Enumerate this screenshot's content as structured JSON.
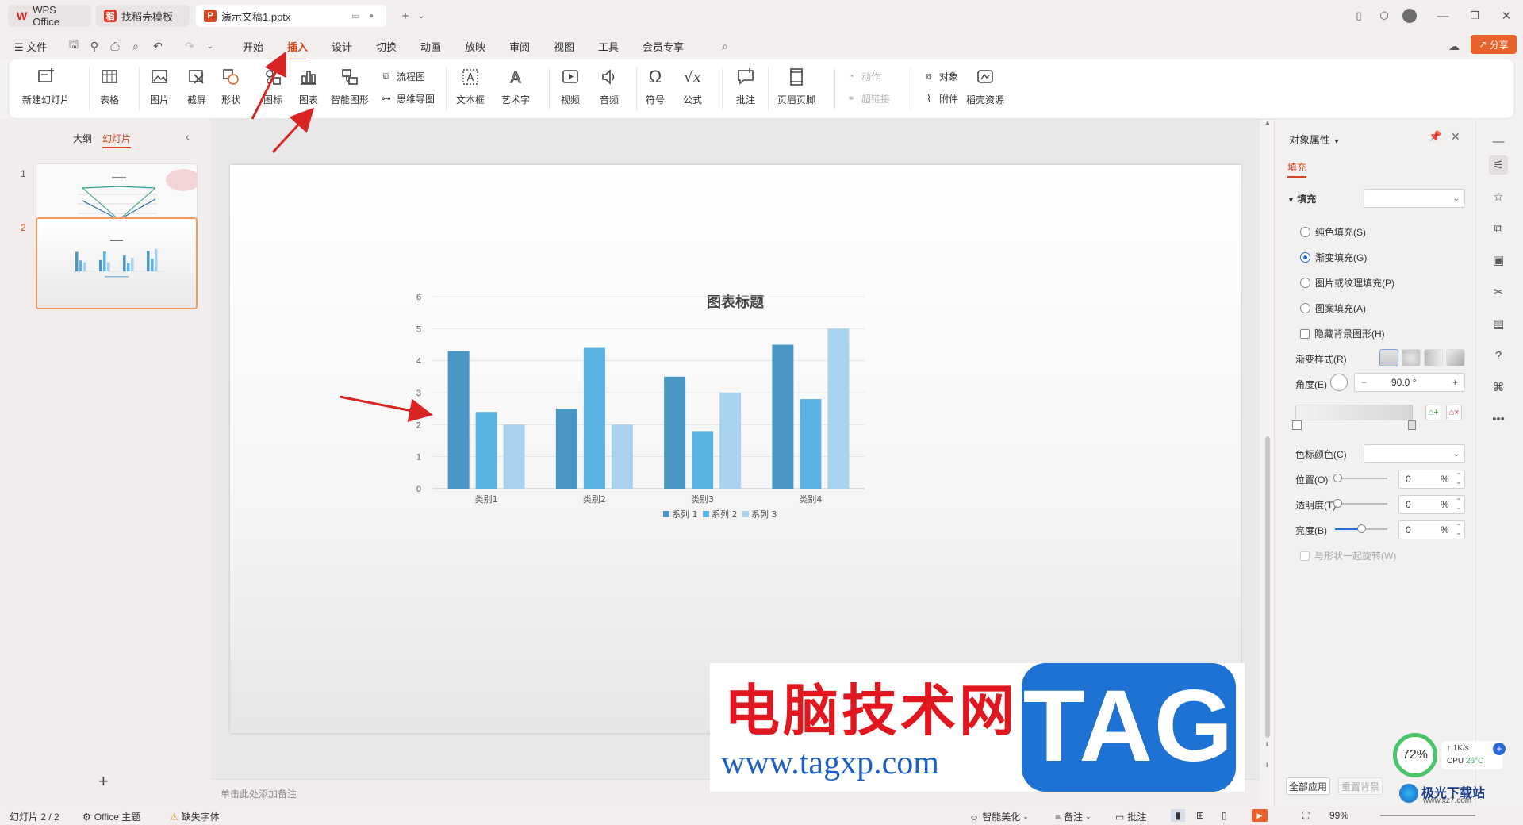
{
  "titlebar": {
    "tabs": [
      {
        "label": "WPS Office",
        "icon": "wps-logo-icon"
      },
      {
        "label": "找稻壳模板",
        "icon": "docer-icon"
      },
      {
        "label": "演示文稿1.pptx",
        "icon": "presentation-icon"
      }
    ]
  },
  "menubar": {
    "file": "文件",
    "items": [
      "开始",
      "插入",
      "设计",
      "切换",
      "动画",
      "放映",
      "审阅",
      "视图",
      "工具",
      "会员专享"
    ],
    "active": "插入",
    "share": "分享"
  },
  "ribbon": {
    "new_slide": "新建幻灯片",
    "table": "表格",
    "picture": "图片",
    "screenshot": "截屏",
    "shape": "形状",
    "icon": "图标",
    "chart": "图表",
    "smartart": "智能图形",
    "flowchart": "流程图",
    "mindmap": "思维导图",
    "textbox": "文本框",
    "wordart": "艺术字",
    "video": "视频",
    "audio": "音频",
    "symbol": "符号",
    "formula": "公式",
    "comment": "批注",
    "header_footer": "页眉页脚",
    "action": "动作",
    "hyperlink": "超链接",
    "object": "对象",
    "attachment": "附件",
    "docer_resources": "稻壳资源"
  },
  "leftpane": {
    "tab_outline": "大纲",
    "tab_slides": "幻灯片",
    "slides": [
      {
        "number": "1",
        "selected": false
      },
      {
        "number": "2",
        "selected": true
      }
    ]
  },
  "chart_data": {
    "type": "bar",
    "title": "图表标题",
    "categories": [
      "类别1",
      "类别2",
      "类别3",
      "类别4"
    ],
    "series": [
      {
        "name": "系列 1",
        "values": [
          4.3,
          2.5,
          3.5,
          4.5
        ],
        "color": "#4a96c4"
      },
      {
        "name": "系列 2",
        "values": [
          2.4,
          4.4,
          1.8,
          2.8
        ],
        "color": "#5bb3e3"
      },
      {
        "name": "系列 3",
        "values": [
          2.0,
          2.0,
          3.0,
          5.0
        ],
        "color": "#a9d2ef"
      }
    ],
    "ylim": [
      0,
      6
    ],
    "yticks": [
      "0",
      "1",
      "2",
      "3",
      "4",
      "5",
      "6"
    ],
    "grid": true,
    "legend": "bottom"
  },
  "notes_placeholder": "单击此处添加备注",
  "rightpane": {
    "title": "对象属性",
    "tab": "填充",
    "section": "填充",
    "fill_options": [
      {
        "label": "纯色填充(S)",
        "checked": false
      },
      {
        "label": "渐变填充(G)",
        "checked": true
      },
      {
        "label": "图片或纹理填充(P)",
        "checked": false
      },
      {
        "label": "图案填充(A)",
        "checked": false
      }
    ],
    "hide_bg": "隐藏背景图形(H)",
    "gradient_style": "渐变样式(R)",
    "angle_label": "角度(E)",
    "angle_value": "90.0 °",
    "stop_color": "色标颜色(C)",
    "position_label": "位置(O)",
    "position_value": "0",
    "transparency_label": "透明度(T)",
    "transparency_value": "0",
    "brightness_label": "亮度(B)",
    "brightness_value": "0",
    "percent": "%",
    "rotate_with_shape": "与形状一起旋转(W)",
    "apply_all": "全部应用",
    "reset_bg": "重置背景"
  },
  "statusbar": {
    "slide_count": "幻灯片 2 / 2",
    "theme": "Office 主题",
    "missing_font": "缺失字体",
    "beautify": "智能美化",
    "notes": "备注",
    "comments": "批注",
    "zoom": "99%"
  },
  "perf_widget": {
    "cpu_pct": "72%",
    "speed": "1K/s",
    "cpu_label": "CPU",
    "temp": "26°C"
  },
  "watermark": {
    "cn_text": "电脑技术网",
    "url": "www.tagxp.com",
    "tag": "TAG",
    "site": "极光下载站",
    "site_url": "www.xz7.com"
  },
  "colors": {
    "accent": "#d9451e",
    "arrow": "#d92424",
    "selection": "#f29a5c",
    "link": "#2a6ad8"
  }
}
